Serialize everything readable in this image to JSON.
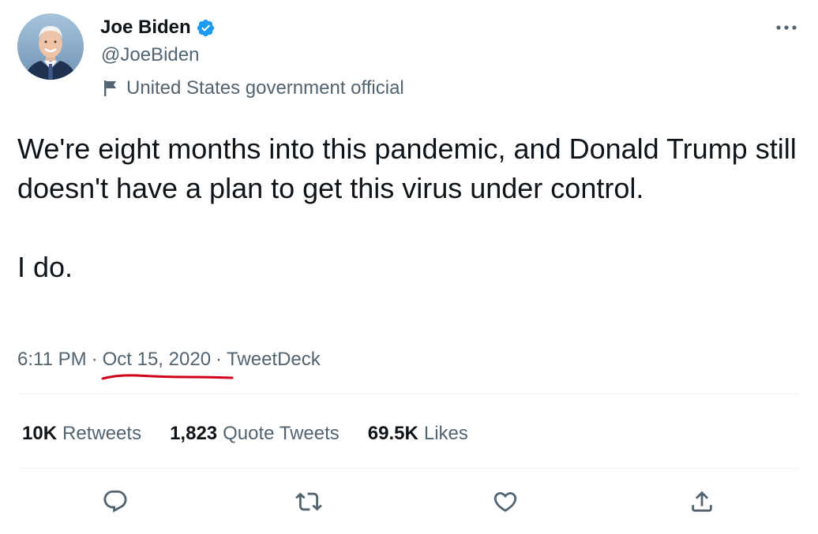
{
  "author": {
    "display_name": "Joe Biden",
    "handle": "@JoeBiden",
    "label": "United States government official",
    "verified": true,
    "verified_color": "#1d9bf0"
  },
  "tweet": {
    "text_paragraph_1": "We're eight months into this pandemic, and Donald Trump still doesn't have a plan to get this virus under control.",
    "text_paragraph_2": "I do."
  },
  "meta": {
    "time": "6:11 PM",
    "date": "Oct 15, 2020",
    "source": "TweetDeck",
    "separator": "·",
    "annotation_color": "#d0021b"
  },
  "stats": {
    "retweets_count": "10K",
    "retweets_label": "Retweets",
    "quotes_count": "1,823",
    "quotes_label": "Quote Tweets",
    "likes_count": "69.5K",
    "likes_label": "Likes"
  },
  "actions": {
    "icons": [
      "reply-icon",
      "retweet-icon",
      "like-icon",
      "share-icon"
    ]
  },
  "colors": {
    "text_primary": "#0f1419",
    "text_secondary": "#536471",
    "divider": "#eff3f4"
  }
}
